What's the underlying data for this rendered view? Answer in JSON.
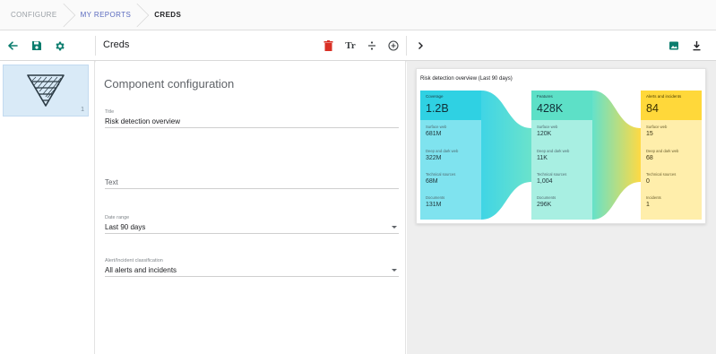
{
  "breadcrumb": {
    "items": [
      {
        "label": "CONFIGURE"
      },
      {
        "label": "MY REPORTS"
      },
      {
        "label": "CREDS"
      }
    ]
  },
  "toolbar": {
    "title": "Creds",
    "text_tool_label": "Tr",
    "icons": [
      "back-arrow-icon",
      "save-icon",
      "settings-icon",
      "delete-icon",
      "text-icon",
      "divider-icon",
      "add-icon",
      "chevron-right-icon",
      "image-icon",
      "download-icon"
    ],
    "accent_color": "#0b7d6e",
    "delete_color": "#d93025"
  },
  "thumbnail": {
    "page_number": "1"
  },
  "config": {
    "heading": "Component configuration",
    "fields": [
      {
        "label": "Title",
        "value": "Risk detection overview",
        "placeholder": ""
      },
      {
        "label": "",
        "value": "",
        "placeholder": "Text"
      },
      {
        "label": "Date range",
        "value": "Last 90 days",
        "placeholder": ""
      },
      {
        "label": "Alert/Incident classification",
        "value": "All alerts and incidents",
        "placeholder": ""
      }
    ]
  },
  "preview": {
    "card_title": "Risk detection overview (Last 90 days)",
    "columns": [
      {
        "header": "Coverage",
        "value": "1.2B",
        "items": [
          {
            "label": "Surface web",
            "value": "681M"
          },
          {
            "label": "Deep and dark web",
            "value": "322M"
          },
          {
            "label": "Technical sources",
            "value": "68M"
          },
          {
            "label": "Documents",
            "value": "131M"
          }
        ]
      },
      {
        "header": "Features",
        "value": "428K",
        "items": [
          {
            "label": "Surface web",
            "value": "120K"
          },
          {
            "label": "Deep and dark web",
            "value": "11K"
          },
          {
            "label": "Technical sources",
            "value": "1,004"
          },
          {
            "label": "Documents",
            "value": "296K"
          }
        ]
      },
      {
        "header": "Alerts and incidents",
        "value": "84",
        "items": [
          {
            "label": "Surface web",
            "value": "15"
          },
          {
            "label": "Deep and dark web",
            "value": "68"
          },
          {
            "label": "Technical sources",
            "value": "0"
          },
          {
            "label": "Incidents",
            "value": "1"
          }
        ]
      }
    ],
    "colors": {
      "coverage": "#2fd1e3",
      "features": "#5de0c7",
      "alerts": "#ffd83a"
    }
  }
}
